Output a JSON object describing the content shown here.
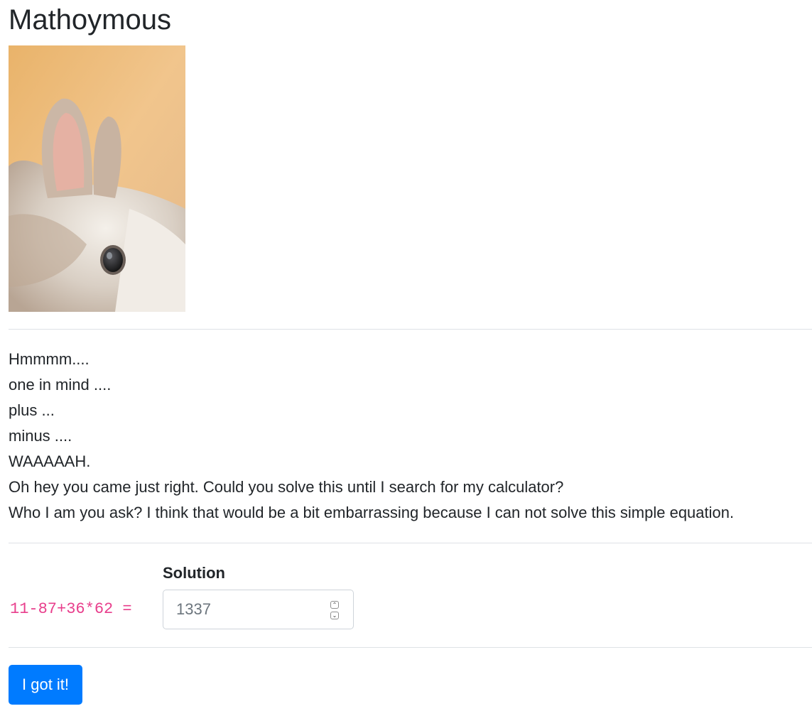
{
  "page": {
    "title": "Mathoymous"
  },
  "story": {
    "lines": [
      "Hmmmm....",
      "one in mind ....",
      "plus ...",
      "minus ....",
      "WAAAAAH.",
      "Oh hey you came just right. Could you solve this until I search for my calculator?",
      "Who I am you ask? I think that would be a bit embarrassing because I can not solve this simple equation."
    ]
  },
  "form": {
    "equation": "11-87+36*62 =",
    "solution_label": "Solution",
    "solution_placeholder": "1337",
    "solution_value": "",
    "submit_label": "I got it!"
  },
  "colors": {
    "equation": "#e83e8c",
    "button": "#007bff"
  }
}
